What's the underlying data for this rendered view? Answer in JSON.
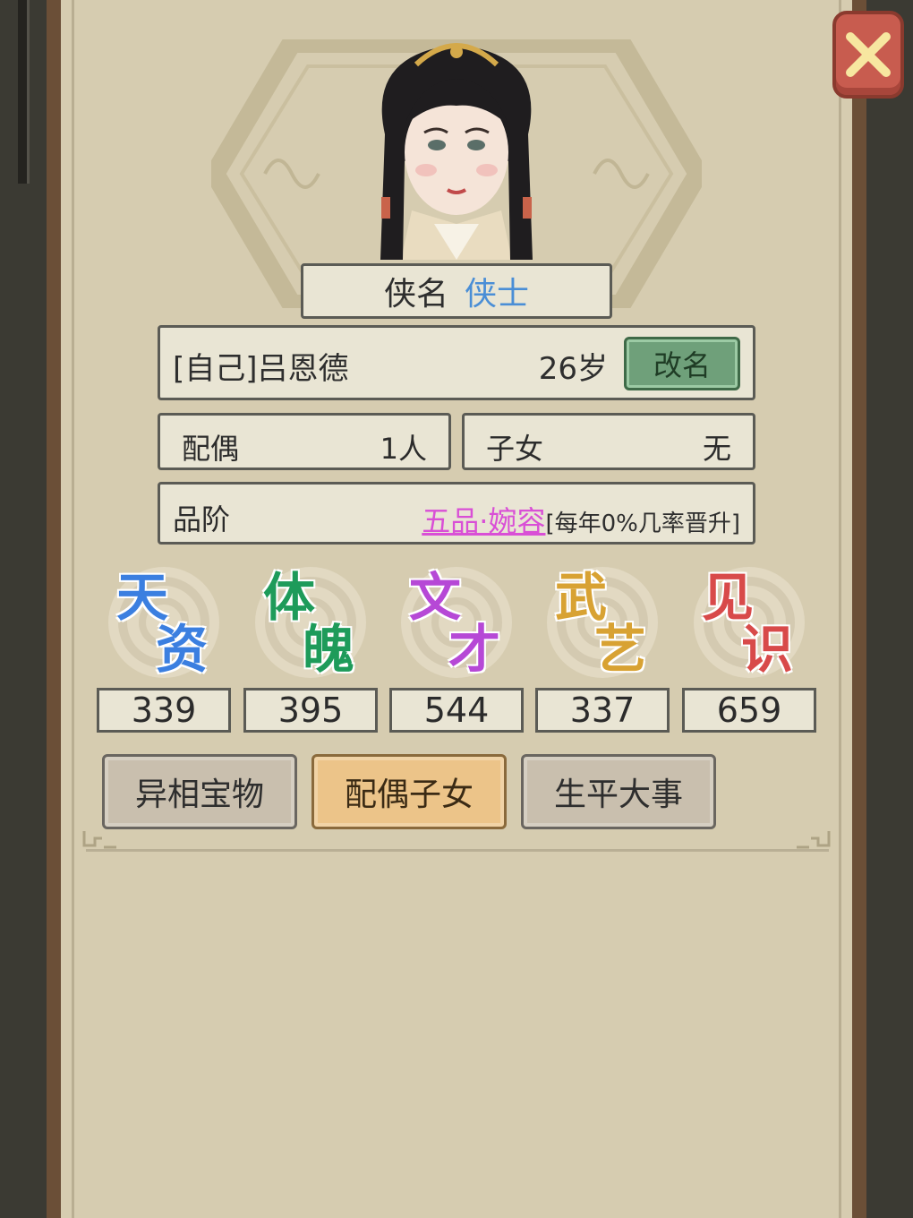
{
  "title": {
    "label": "侠名",
    "value": "侠士"
  },
  "profile": {
    "name": "[自己]吕恩德",
    "age": "26岁",
    "rename_label": "改名"
  },
  "family": {
    "spouse_label": "配偶",
    "spouse_value": "1人",
    "children_label": "子女",
    "children_value": "无"
  },
  "rank": {
    "label": "品阶",
    "value": "五品·婉容",
    "note": "[每年0%几率晋升]"
  },
  "stats": [
    {
      "c1": "天",
      "c2": "资",
      "value": "339",
      "color": "#3b7fe0"
    },
    {
      "c1": "体",
      "c2": "魄",
      "value": "395",
      "color": "#1e9b5a"
    },
    {
      "c1": "文",
      "c2": "才",
      "value": "544",
      "color": "#b648d6"
    },
    {
      "c1": "武",
      "c2": "艺",
      "value": "337",
      "color": "#d8a233"
    },
    {
      "c1": "见",
      "c2": "识",
      "value": "659",
      "color": "#d84a4a"
    }
  ],
  "tabs": [
    {
      "label": "异相宝物",
      "active": false
    },
    {
      "label": "配偶子女",
      "active": true
    },
    {
      "label": "生平大事",
      "active": false
    }
  ],
  "icons": {
    "close": "close-x-icon"
  }
}
